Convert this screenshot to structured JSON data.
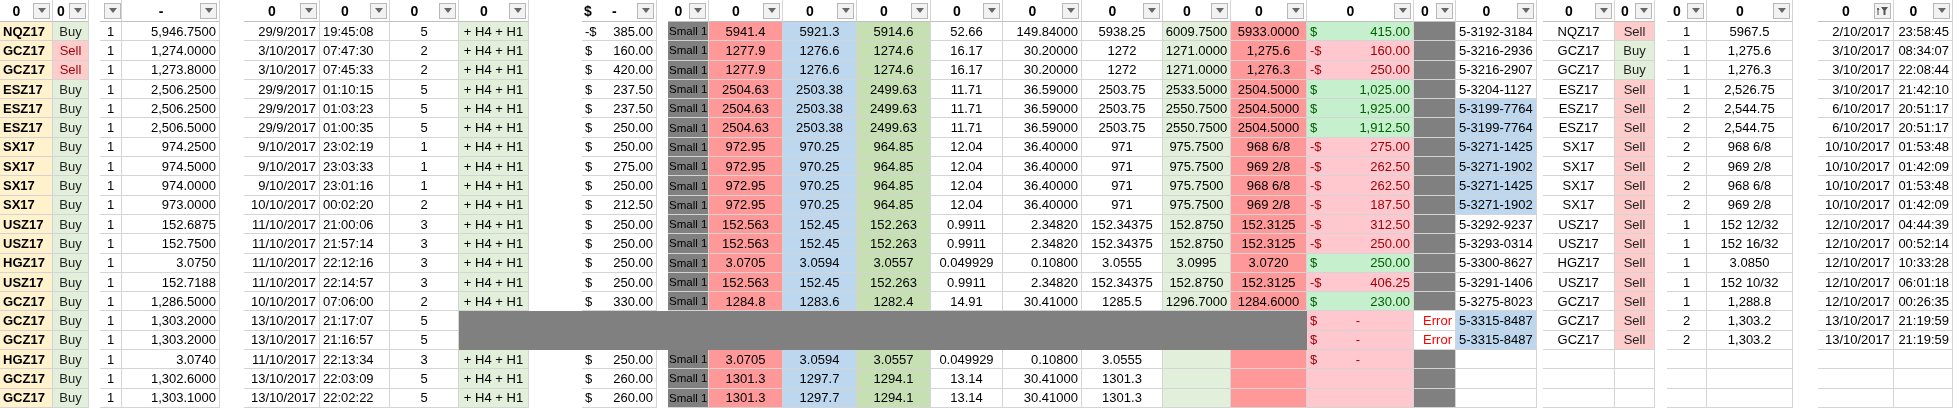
{
  "columns": [
    {
      "header": "0",
      "filtered": false
    },
    {
      "header": "0",
      "filtered": false
    },
    {
      "filtered": false
    },
    {
      "header": "-",
      "filtered": false
    },
    {
      "header": "0",
      "filtered": false
    },
    {
      "header": "0",
      "filtered": false
    },
    {
      "header": "0",
      "filtered": false
    },
    {
      "header": "0",
      "filtered": false
    },
    {
      "sign": "$",
      "header": "-",
      "filtered": false
    },
    {
      "header": "0",
      "filtered": false
    },
    {
      "header": "0",
      "filtered": false
    },
    {
      "header": "0",
      "filtered": false
    },
    {
      "header": "0",
      "filtered": false
    },
    {
      "header": "0",
      "filtered": false
    },
    {
      "header": "0",
      "filtered": false
    },
    {
      "header": "0",
      "filtered": false
    },
    {
      "header": "0",
      "filtered": false
    },
    {
      "header": "0",
      "filtered": false
    },
    {
      "header": "0",
      "filtered": false
    },
    {
      "header": "0",
      "filtered": false
    },
    {
      "header": "0",
      "filtered": false
    },
    {
      "header": "0",
      "filtered": false
    },
    {
      "header": "0",
      "filtered": false
    },
    {
      "header": "0",
      "filtered": false
    },
    {
      "header": "0",
      "filtered": false
    },
    {
      "header": "0",
      "filtered": true
    },
    {
      "header": "0",
      "filtered": false
    }
  ],
  "rows": [
    {
      "kind": "trade",
      "symbol": "NQZ17",
      "side": "Buy",
      "sell": false,
      "qty": "1",
      "price": "5,946.7500",
      "date": "29/9/2017",
      "time": "19:45:08",
      "count": "5",
      "setup": "+ H4 + H1",
      "risk_sign": "-$",
      "risk": "385.00",
      "small": "Small 1",
      "high": "5941.4",
      "mid": "5921.3",
      "low": "5914.6",
      "range": "52.66",
      "c14": "149.84000",
      "c15": "5938.25",
      "target": "6009.7500",
      "stop": "5933.0000",
      "pnl_sign": "$",
      "pnl": "415.00",
      "pnl_negative": false,
      "order_id": "5-3192-3184",
      "highlighted": false,
      "symbol2": "NQZ17",
      "side2": "Sell",
      "sell2": true,
      "qty2": "1",
      "fill": "5967.5",
      "date2": "2/10/2017",
      "time2": "23:58:45"
    },
    {
      "kind": "trade",
      "symbol": "GCZ17",
      "side": "Sell",
      "sell": true,
      "qty": "1",
      "price": "1,274.0000",
      "date": "3/10/2017",
      "time": "07:47:30",
      "count": "2",
      "setup": "+ H4 + H1",
      "risk_sign": "$",
      "risk": "160.00",
      "small": "Small 1",
      "high": "1277.9",
      "mid": "1276.6",
      "low": "1274.6",
      "range": "16.17",
      "c14": "30.20000",
      "c15": "1272",
      "target": "1271.0000",
      "stop": "1,275.6",
      "pnl_sign": "-$",
      "pnl": "160.00",
      "pnl_negative": true,
      "order_id": "5-3216-2936",
      "highlighted": false,
      "symbol2": "GCZ17",
      "side2": "Buy",
      "sell2": false,
      "qty2": "1",
      "fill": "1,275.6",
      "date2": "3/10/2017",
      "time2": "08:34:07"
    },
    {
      "kind": "trade",
      "symbol": "GCZ17",
      "side": "Sell",
      "sell": true,
      "qty": "1",
      "price": "1,273.8000",
      "date": "3/10/2017",
      "time": "07:45:33",
      "count": "2",
      "setup": "+ H4 + H1",
      "risk_sign": "$",
      "risk": "420.00",
      "small": "Small 1",
      "high": "1277.9",
      "mid": "1276.6",
      "low": "1274.6",
      "range": "16.17",
      "c14": "30.20000",
      "c15": "1272",
      "target": "1271.0000",
      "stop": "1,276.3",
      "pnl_sign": "-$",
      "pnl": "250.00",
      "pnl_negative": true,
      "order_id": "5-3216-2907",
      "highlighted": false,
      "symbol2": "GCZ17",
      "side2": "Buy",
      "sell2": false,
      "qty2": "1",
      "fill": "1,276.3",
      "date2": "3/10/2017",
      "time2": "22:08:44"
    },
    {
      "kind": "trade",
      "symbol": "ESZ17",
      "side": "Buy",
      "sell": false,
      "qty": "1",
      "price": "2,506.2500",
      "date": "29/9/2017",
      "time": "01:10:15",
      "count": "5",
      "setup": "+ H4 + H1",
      "risk_sign": "$",
      "risk": "237.50",
      "small": "Small 1",
      "high": "2504.63",
      "mid": "2503.38",
      "low": "2499.63",
      "range": "11.71",
      "c14": "36.59000",
      "c15": "2503.75",
      "target": "2533.5000",
      "stop": "2504.5000",
      "pnl_sign": "$",
      "pnl": "1,025.00",
      "pnl_negative": false,
      "order_id": "5-3204-1127",
      "highlighted": false,
      "symbol2": "ESZ17",
      "side2": "Sell",
      "sell2": true,
      "qty2": "1",
      "fill": "2,526.75",
      "date2": "3/10/2017",
      "time2": "21:42:10"
    },
    {
      "kind": "trade",
      "symbol": "ESZ17",
      "side": "Buy",
      "sell": false,
      "qty": "1",
      "price": "2,506.2500",
      "date": "29/9/2017",
      "time": "01:03:23",
      "count": "5",
      "setup": "+ H4 + H1",
      "risk_sign": "$",
      "risk": "237.50",
      "small": "Small 1",
      "high": "2504.63",
      "mid": "2503.38",
      "low": "2499.63",
      "range": "11.71",
      "c14": "36.59000",
      "c15": "2503.75",
      "target": "2550.7500",
      "stop": "2504.5000",
      "pnl_sign": "$",
      "pnl": "1,925.00",
      "pnl_negative": false,
      "order_id": "5-3199-7764",
      "highlighted": true,
      "symbol2": "ESZ17",
      "side2": "Sell",
      "sell2": true,
      "qty2": "2",
      "fill": "2,544.75",
      "date2": "6/10/2017",
      "time2": "20:51:17"
    },
    {
      "kind": "trade",
      "symbol": "ESZ17",
      "side": "Buy",
      "sell": false,
      "qty": "1",
      "price": "2,506.5000",
      "date": "29/9/2017",
      "time": "01:00:35",
      "count": "5",
      "setup": "+ H4 + H1",
      "risk_sign": "$",
      "risk": "250.00",
      "small": "Small 1",
      "high": "2504.63",
      "mid": "2503.38",
      "low": "2499.63",
      "range": "11.71",
      "c14": "36.59000",
      "c15": "2503.75",
      "target": "2550.7500",
      "stop": "2504.5000",
      "pnl_sign": "$",
      "pnl": "1,912.50",
      "pnl_negative": false,
      "order_id": "5-3199-7764",
      "highlighted": true,
      "symbol2": "ESZ17",
      "side2": "Sell",
      "sell2": true,
      "qty2": "2",
      "fill": "2,544.75",
      "date2": "6/10/2017",
      "time2": "20:51:17"
    },
    {
      "kind": "trade",
      "symbol": "SX17",
      "side": "Buy",
      "sell": false,
      "qty": "1",
      "price": "974.2500",
      "date": "9/10/2017",
      "time": "23:02:19",
      "count": "1",
      "setup": "+ H4 + H1",
      "risk_sign": "$",
      "risk": "250.00",
      "small": "Small 1",
      "high": "972.95",
      "mid": "970.25",
      "low": "964.85",
      "range": "12.04",
      "c14": "36.40000",
      "c15": "971",
      "target": "975.7500",
      "stop": "968 6/8",
      "pnl_sign": "-$",
      "pnl": "275.00",
      "pnl_negative": true,
      "order_id": "5-3271-1425",
      "highlighted": true,
      "symbol2": "SX17",
      "side2": "Sell",
      "sell2": true,
      "qty2": "2",
      "fill": "968 6/8",
      "date2": "10/10/2017",
      "time2": "01:53:48"
    },
    {
      "kind": "trade",
      "symbol": "SX17",
      "side": "Buy",
      "sell": false,
      "qty": "1",
      "price": "974.5000",
      "date": "9/10/2017",
      "time": "23:03:33",
      "count": "1",
      "setup": "+ H4 + H1",
      "risk_sign": "$",
      "risk": "275.00",
      "small": "Small 1",
      "high": "972.95",
      "mid": "970.25",
      "low": "964.85",
      "range": "12.04",
      "c14": "36.40000",
      "c15": "971",
      "target": "975.7500",
      "stop": "969 2/8",
      "pnl_sign": "-$",
      "pnl": "262.50",
      "pnl_negative": true,
      "order_id": "5-3271-1902",
      "highlighted": true,
      "symbol2": "SX17",
      "side2": "Sell",
      "sell2": true,
      "qty2": "2",
      "fill": "969 2/8",
      "date2": "10/10/2017",
      "time2": "01:42:09"
    },
    {
      "kind": "trade",
      "symbol": "SX17",
      "side": "Buy",
      "sell": false,
      "qty": "1",
      "price": "974.0000",
      "date": "9/10/2017",
      "time": "23:01:16",
      "count": "1",
      "setup": "+ H4 + H1",
      "risk_sign": "$",
      "risk": "250.00",
      "small": "Small 1",
      "high": "972.95",
      "mid": "970.25",
      "low": "964.85",
      "range": "12.04",
      "c14": "36.40000",
      "c15": "971",
      "target": "975.7500",
      "stop": "968 6/8",
      "pnl_sign": "-$",
      "pnl": "262.50",
      "pnl_negative": true,
      "order_id": "5-3271-1425",
      "highlighted": true,
      "symbol2": "SX17",
      "side2": "Sell",
      "sell2": true,
      "qty2": "2",
      "fill": "968 6/8",
      "date2": "10/10/2017",
      "time2": "01:53:48"
    },
    {
      "kind": "trade",
      "symbol": "SX17",
      "side": "Buy",
      "sell": false,
      "qty": "1",
      "price": "973.0000",
      "date": "10/10/2017",
      "time": "00:02:20",
      "count": "2",
      "setup": "+ H4 + H1",
      "risk_sign": "$",
      "risk": "212.50",
      "small": "Small 1",
      "high": "972.95",
      "mid": "970.25",
      "low": "964.85",
      "range": "12.04",
      "c14": "36.40000",
      "c15": "971",
      "target": "975.7500",
      "stop": "969 2/8",
      "pnl_sign": "-$",
      "pnl": "187.50",
      "pnl_negative": true,
      "order_id": "5-3271-1902",
      "highlighted": true,
      "symbol2": "SX17",
      "side2": "Sell",
      "sell2": true,
      "qty2": "2",
      "fill": "969 2/8",
      "date2": "10/10/2017",
      "time2": "01:42:09"
    },
    {
      "kind": "trade",
      "symbol": "USZ17",
      "side": "Buy",
      "sell": false,
      "qty": "1",
      "price": "152.6875",
      "date": "11/10/2017",
      "time": "21:00:06",
      "count": "3",
      "setup": "+ H4 + H1",
      "risk_sign": "$",
      "risk": "250.00",
      "small": "Small 1",
      "high": "152.563",
      "mid": "152.45",
      "low": "152.263",
      "range": "0.9911",
      "c14": "2.34820",
      "c15": "152.34375",
      "target": "152.8750",
      "stop": "152.3125",
      "pnl_sign": "-$",
      "pnl": "312.50",
      "pnl_negative": true,
      "order_id": "5-3292-9237",
      "highlighted": false,
      "symbol2": "USZ17",
      "side2": "Sell",
      "sell2": true,
      "qty2": "1",
      "fill": "152 12/32",
      "date2": "12/10/2017",
      "time2": "04:44:39"
    },
    {
      "kind": "trade",
      "symbol": "USZ17",
      "side": "Buy",
      "sell": false,
      "qty": "1",
      "price": "152.7500",
      "date": "11/10/2017",
      "time": "21:57:14",
      "count": "3",
      "setup": "+ H4 + H1",
      "risk_sign": "$",
      "risk": "250.00",
      "small": "Small 1",
      "high": "152.563",
      "mid": "152.45",
      "low": "152.263",
      "range": "0.9911",
      "c14": "2.34820",
      "c15": "152.34375",
      "target": "152.8750",
      "stop": "152.3125",
      "pnl_sign": "-$",
      "pnl": "250.00",
      "pnl_negative": true,
      "order_id": "5-3293-0314",
      "highlighted": false,
      "symbol2": "USZ17",
      "side2": "Sell",
      "sell2": true,
      "qty2": "1",
      "fill": "152 16/32",
      "date2": "12/10/2017",
      "time2": "00:52:14"
    },
    {
      "kind": "trade",
      "symbol": "HGZ17",
      "side": "Buy",
      "sell": false,
      "qty": "1",
      "price": "3.0750",
      "date": "11/10/2017",
      "time": "22:12:16",
      "count": "3",
      "setup": "+ H4 + H1",
      "risk_sign": "$",
      "risk": "250.00",
      "small": "Small 1",
      "high": "3.0705",
      "mid": "3.0594",
      "low": "3.0557",
      "range": "0.049929",
      "c14": "0.10800",
      "c15": "3.0555",
      "target": "3.0995",
      "stop": "3.0720",
      "pnl_sign": "$",
      "pnl": "250.00",
      "pnl_negative": false,
      "order_id": "5-3300-8627",
      "highlighted": false,
      "symbol2": "HGZ17",
      "side2": "Sell",
      "sell2": true,
      "qty2": "1",
      "fill": "3.0850",
      "date2": "12/10/2017",
      "time2": "10:33:28"
    },
    {
      "kind": "trade",
      "symbol": "USZ17",
      "side": "Buy",
      "sell": false,
      "qty": "1",
      "price": "152.7188",
      "date": "11/10/2017",
      "time": "22:14:57",
      "count": "3",
      "setup": "+ H4 + H1",
      "risk_sign": "$",
      "risk": "250.00",
      "small": "Small 1",
      "high": "152.563",
      "mid": "152.45",
      "low": "152.263",
      "range": "0.9911",
      "c14": "2.34820",
      "c15": "152.34375",
      "target": "152.8750",
      "stop": "152.3125",
      "pnl_sign": "-$",
      "pnl": "406.25",
      "pnl_negative": true,
      "order_id": "5-3291-1406",
      "highlighted": false,
      "symbol2": "USZ17",
      "side2": "Sell",
      "sell2": true,
      "qty2": "1",
      "fill": "152 10/32",
      "date2": "12/10/2017",
      "time2": "06:01:18"
    },
    {
      "kind": "trade",
      "symbol": "GCZ17",
      "side": "Buy",
      "sell": false,
      "qty": "1",
      "price": "1,286.5000",
      "date": "10/10/2017",
      "time": "07:06:00",
      "count": "2",
      "setup": "+ H4 + H1",
      "risk_sign": "$",
      "risk": "330.00",
      "small": "Small 1",
      "high": "1284.8",
      "mid": "1283.6",
      "low": "1282.4",
      "range": "14.91",
      "c14": "30.41000",
      "c15": "1285.5",
      "target": "1296.7000",
      "stop": "1284.6000",
      "pnl_sign": "$",
      "pnl": "230.00",
      "pnl_negative": false,
      "order_id": "5-3275-8023",
      "highlighted": false,
      "symbol2": "GCZ17",
      "side2": "Sell",
      "sell2": true,
      "qty2": "1",
      "fill": "1,288.8",
      "date2": "12/10/2017",
      "time2": "00:26:35"
    },
    {
      "kind": "voided",
      "symbol": "GCZ17",
      "side": "Buy",
      "sell": false,
      "qty": "1",
      "price": "1,303.2000",
      "date": "13/10/2017",
      "time": "21:17:07",
      "count": "5",
      "pnl_sign": "$",
      "pnl": "-",
      "pnl_negative": true,
      "status": "Error",
      "order_id": "5-3315-8487",
      "highlighted": true,
      "symbol2": "GCZ17",
      "side2": "Sell",
      "sell2": true,
      "qty2": "2",
      "fill": "1,303.2",
      "date2": "13/10/2017",
      "time2": "21:19:59"
    },
    {
      "kind": "voided",
      "symbol": "GCZ17",
      "side": "Buy",
      "sell": false,
      "qty": "1",
      "price": "1,303.2000",
      "date": "13/10/2017",
      "time": "21:16:57",
      "count": "5",
      "pnl_sign": "$",
      "pnl": "-",
      "pnl_negative": true,
      "status": "Error",
      "order_id": "5-3315-8487",
      "highlighted": true,
      "symbol2": "GCZ17",
      "side2": "Sell",
      "sell2": true,
      "qty2": "2",
      "fill": "1,303.2",
      "date2": "13/10/2017",
      "time2": "21:19:59"
    },
    {
      "kind": "trade",
      "symbol": "HGZ17",
      "side": "Buy",
      "sell": false,
      "qty": "1",
      "price": "3.0740",
      "date": "11/10/2017",
      "time": "22:13:34",
      "count": "3",
      "setup": "+ H4 + H1",
      "risk_sign": "$",
      "risk": "250.00",
      "small": "Small 1",
      "high": "3.0705",
      "mid": "3.0594",
      "low": "3.0557",
      "range": "0.049929",
      "c14": "0.10800",
      "c15": "3.0555",
      "pnl_sign": "$",
      "pnl": "-",
      "pnl_negative": true,
      "highlighted": false
    },
    {
      "kind": "trade",
      "symbol": "GCZ17",
      "side": "Buy",
      "sell": false,
      "qty": "1",
      "price": "1,302.6000",
      "date": "13/10/2017",
      "time": "22:03:09",
      "count": "5",
      "setup": "+ H4 + H1",
      "risk_sign": "$",
      "risk": "260.00",
      "small": "Small 1",
      "high": "1301.3",
      "mid": "1297.7",
      "low": "1294.1",
      "range": "13.14",
      "c14": "30.41000",
      "c15": "1301.3",
      "pnl_negative": true,
      "highlighted": false
    },
    {
      "kind": "trade",
      "symbol": "GCZ17",
      "side": "Buy",
      "sell": false,
      "qty": "1",
      "price": "1,303.1000",
      "date": "13/10/2017",
      "time": "22:02:22",
      "count": "5",
      "setup": "+ H4 + H1",
      "risk_sign": "$",
      "risk": "260.00",
      "small": "Small 1",
      "high": "1301.3",
      "mid": "1297.7",
      "low": "1294.1",
      "range": "13.14",
      "c14": "30.41000",
      "c15": "1301.3",
      "pnl_negative": true,
      "highlighted": false
    }
  ]
}
